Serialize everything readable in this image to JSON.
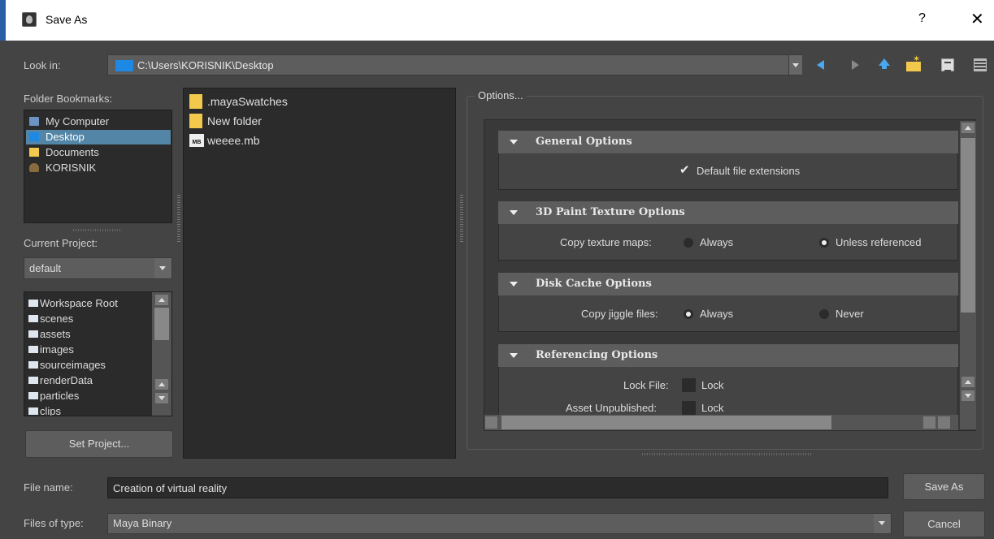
{
  "window": {
    "title": "Save As",
    "help_label": "?",
    "close_label": "✕"
  },
  "look_in": {
    "label": "Look in:",
    "path": "C:\\Users\\KORISNIK\\Desktop"
  },
  "bookmarks": {
    "label": "Folder Bookmarks:",
    "items": [
      {
        "label": "My Computer",
        "icon": "computer-icon"
      },
      {
        "label": "Desktop",
        "icon": "desktop-icon",
        "selected": true
      },
      {
        "label": "Documents",
        "icon": "folder-icon"
      },
      {
        "label": "KORISNIK",
        "icon": "user-icon"
      }
    ]
  },
  "current_project": {
    "label": "Current Project:",
    "value": "default"
  },
  "project_tree": {
    "items": [
      "Workspace Root",
      "scenes",
      "assets",
      "images",
      "sourceimages",
      "renderData",
      "particles",
      "clips"
    ]
  },
  "set_project_label": "Set Project...",
  "files": [
    {
      "name": ".mayaSwatches",
      "icon": "folder-icon"
    },
    {
      "name": "New folder",
      "icon": "folder-icon"
    },
    {
      "name": "weeee.mb",
      "icon": "mb-file-icon"
    }
  ],
  "options": {
    "title": "Options...",
    "sections": [
      {
        "header": "General Options",
        "checkbox_label": "Default file extensions"
      },
      {
        "header": "3D Paint Texture Options",
        "row_label": "Copy texture maps:",
        "opt_a": "Always",
        "opt_b": "Unless referenced"
      },
      {
        "header": "Disk Cache Options",
        "row_label": "Copy jiggle files:",
        "opt_a": "Always",
        "opt_b": "Never"
      },
      {
        "header": "Referencing Options",
        "row1_label": "Lock File:",
        "row1_check": "Lock",
        "row2_label": "Asset Unpublished:",
        "row2_check": "Lock"
      }
    ]
  },
  "file_name": {
    "label": "File name:",
    "value": "Creation of virtual reality"
  },
  "file_type": {
    "label": "Files of type:",
    "value": "Maya Binary"
  },
  "buttons": {
    "save": "Save As",
    "cancel": "Cancel"
  },
  "colors": {
    "background": "#444444",
    "selection": "#5285a6",
    "title_accent": "#2a5fa8"
  }
}
